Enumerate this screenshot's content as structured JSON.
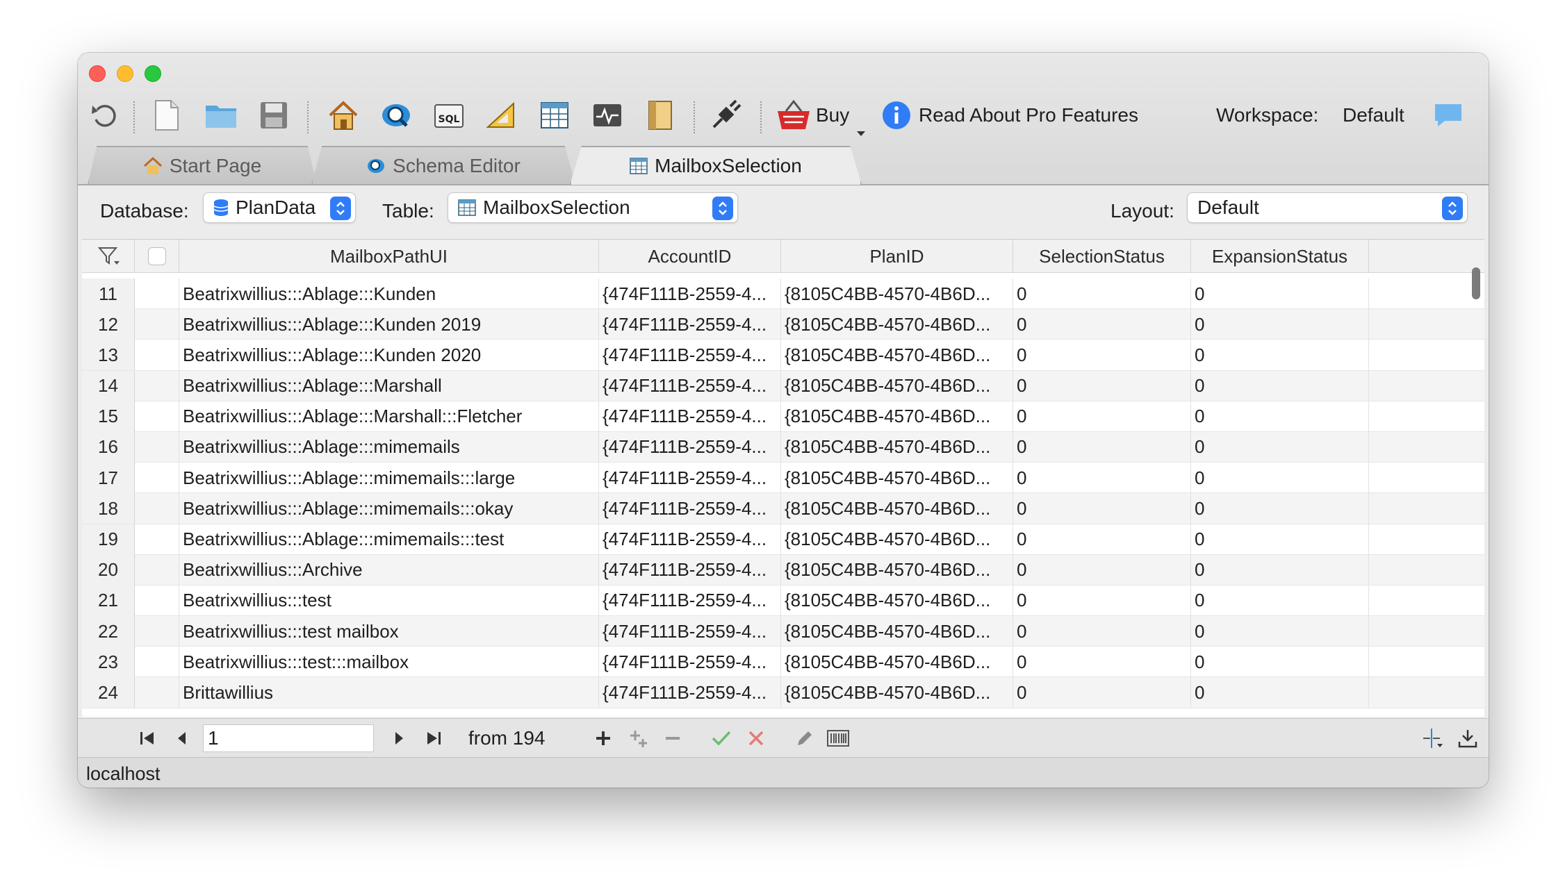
{
  "toolbar": {
    "buy_label": "Buy",
    "pro_label": "Read About Pro Features",
    "workspace_label": "Workspace:",
    "workspace_value": "Default",
    "icons": [
      "undo-icon",
      "new-file-icon",
      "open-folder-icon",
      "save-icon",
      "home-icon",
      "schema-search-icon",
      "sql-icon",
      "ruler-icon",
      "table-icon",
      "monitor-icon",
      "notebook-icon",
      "connect-plug-icon",
      "basket-icon",
      "info-icon",
      "chat-bubble-icon"
    ]
  },
  "tabs": [
    {
      "label": "Start Page"
    },
    {
      "label": "Schema Editor"
    },
    {
      "label": "MailboxSelection"
    }
  ],
  "selector": {
    "database_label": "Database:",
    "database_value": "PlanData",
    "table_label": "Table:",
    "table_value": "MailboxSelection",
    "layout_label": "Layout:",
    "layout_value": "Default"
  },
  "table": {
    "columns": [
      "MailboxPathUI",
      "AccountID",
      "PlanID",
      "SelectionStatus",
      "ExpansionStatus"
    ],
    "rows": [
      {
        "n": "11",
        "path": "Beatrixwillius:::Ablage:::Kunden",
        "acc": "{474F111B-2559-4...",
        "plan": "{8105C4BB-4570-4B6D...",
        "sel": "0",
        "exp": "0"
      },
      {
        "n": "12",
        "path": "Beatrixwillius:::Ablage:::Kunden 2019",
        "acc": "{474F111B-2559-4...",
        "plan": "{8105C4BB-4570-4B6D...",
        "sel": "0",
        "exp": "0"
      },
      {
        "n": "13",
        "path": "Beatrixwillius:::Ablage:::Kunden 2020",
        "acc": "{474F111B-2559-4...",
        "plan": "{8105C4BB-4570-4B6D...",
        "sel": "0",
        "exp": "0"
      },
      {
        "n": "14",
        "path": "Beatrixwillius:::Ablage:::Marshall",
        "acc": "{474F111B-2559-4...",
        "plan": "{8105C4BB-4570-4B6D...",
        "sel": "0",
        "exp": "0"
      },
      {
        "n": "15",
        "path": "Beatrixwillius:::Ablage:::Marshall:::Fletcher",
        "acc": "{474F111B-2559-4...",
        "plan": "{8105C4BB-4570-4B6D...",
        "sel": "0",
        "exp": "0"
      },
      {
        "n": "16",
        "path": "Beatrixwillius:::Ablage:::mimemails",
        "acc": "{474F111B-2559-4...",
        "plan": "{8105C4BB-4570-4B6D...",
        "sel": "0",
        "exp": "0"
      },
      {
        "n": "17",
        "path": "Beatrixwillius:::Ablage:::mimemails:::large",
        "acc": "{474F111B-2559-4...",
        "plan": "{8105C4BB-4570-4B6D...",
        "sel": "0",
        "exp": "0"
      },
      {
        "n": "18",
        "path": "Beatrixwillius:::Ablage:::mimemails:::okay",
        "acc": "{474F111B-2559-4...",
        "plan": "{8105C4BB-4570-4B6D...",
        "sel": "0",
        "exp": "0"
      },
      {
        "n": "19",
        "path": "Beatrixwillius:::Ablage:::mimemails:::test",
        "acc": "{474F111B-2559-4...",
        "plan": "{8105C4BB-4570-4B6D...",
        "sel": "0",
        "exp": "0"
      },
      {
        "n": "20",
        "path": "Beatrixwillius:::Archive",
        "acc": "{474F111B-2559-4...",
        "plan": "{8105C4BB-4570-4B6D...",
        "sel": "0",
        "exp": "0"
      },
      {
        "n": "21",
        "path": "Beatrixwillius:::test",
        "acc": "{474F111B-2559-4...",
        "plan": "{8105C4BB-4570-4B6D...",
        "sel": "0",
        "exp": "0"
      },
      {
        "n": "22",
        "path": "Beatrixwillius:::test mailbox",
        "acc": "{474F111B-2559-4...",
        "plan": "{8105C4BB-4570-4B6D...",
        "sel": "0",
        "exp": "0"
      },
      {
        "n": "23",
        "path": "Beatrixwillius:::test:::mailbox",
        "acc": "{474F111B-2559-4...",
        "plan": "{8105C4BB-4570-4B6D...",
        "sel": "0",
        "exp": "0"
      },
      {
        "n": "24",
        "path": "Brittawillius",
        "acc": "{474F111B-2559-4...",
        "plan": "{8105C4BB-4570-4B6D...",
        "sel": "0",
        "exp": "0"
      }
    ]
  },
  "navbar": {
    "page_value": "1",
    "from_text": "from 194"
  },
  "status": {
    "host": "localhost"
  },
  "colors": {
    "accent": "#2f7cf6",
    "apply": "#3fae47",
    "cancel": "#e0443e"
  }
}
